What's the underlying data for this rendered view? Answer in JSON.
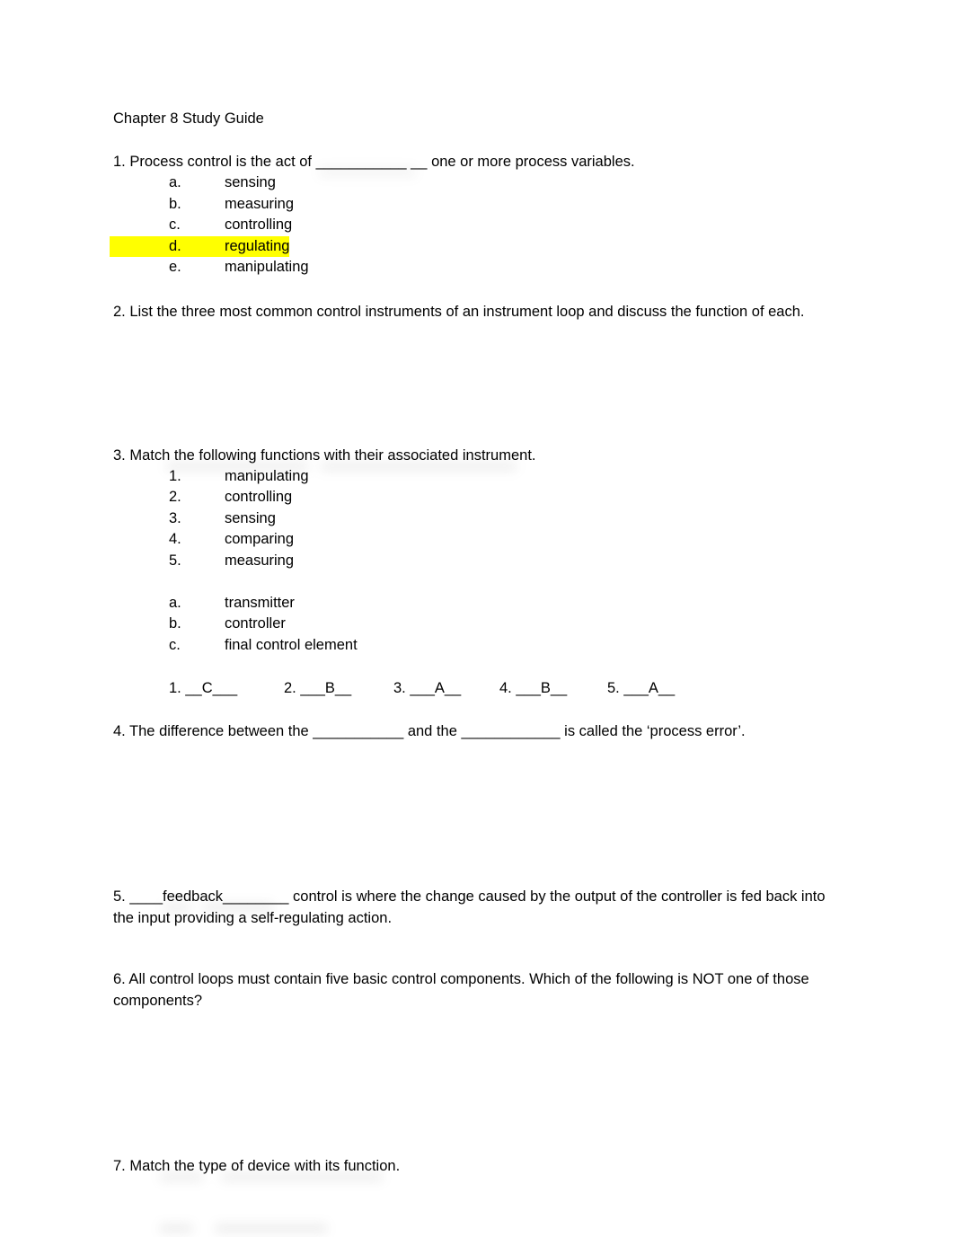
{
  "document": {
    "title": "Chapter 8 Study Guide",
    "page_background": "#ffffff",
    "text_color": "#000000",
    "highlight_color": "#ffff00"
  },
  "questions": {
    "q1": {
      "text": "1.  Process control is the act of ___________ __ one or more process variables.",
      "options": [
        {
          "marker": "a.",
          "label": "sensing",
          "highlighted": false
        },
        {
          "marker": "b.",
          "label": "measuring",
          "highlighted": false
        },
        {
          "marker": "c.",
          "label": "controlling",
          "highlighted": false
        },
        {
          "marker": "d.",
          "label": "regulating",
          "highlighted": true
        },
        {
          "marker": "e.",
          "label": "manipulating",
          "highlighted": false
        }
      ]
    },
    "q2": {
      "text": "2.  List the three most common control instruments of an instrument loop and discuss the function of each."
    },
    "q3": {
      "text": "3.  Match the following functions with their associated instrument.",
      "functions": [
        {
          "marker": "1.",
          "label": "manipulating"
        },
        {
          "marker": "2.",
          "label": "controlling"
        },
        {
          "marker": "3.",
          "label": "sensing"
        },
        {
          "marker": "4.",
          "label": "comparing"
        },
        {
          "marker": "5.",
          "label": "measuring"
        }
      ],
      "instruments": [
        {
          "marker": "a.",
          "label": "transmitter"
        },
        {
          "marker": "b.",
          "label": "controller"
        },
        {
          "marker": "c.",
          "label": "final control element"
        }
      ],
      "answers": [
        "1. __C___",
        "2. ___B__",
        "3. ___A__",
        "4. ___B__",
        "5. ___A__"
      ]
    },
    "q4": {
      "text": "4. The difference between the ___________ and the ____________ is called the ‘process error’."
    },
    "q5": {
      "text": "5.  ____feedback________ control is where the change caused by the output of the controller is fed back into the input providing a self-regulating action."
    },
    "q6": {
      "text": "6.  All control loops must contain five basic control components. Which of the following is NOT one of those components?"
    },
    "q7": {
      "text": "7.  Match the type of device with its function."
    }
  }
}
